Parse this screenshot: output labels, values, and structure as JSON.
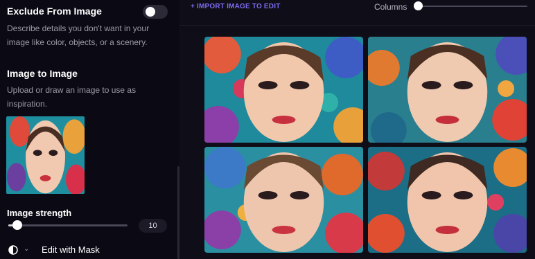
{
  "sidebar": {
    "exclude": {
      "title": "Exclude From Image",
      "description": "Describe details you don't want in your image like color, objects, or a scenery.",
      "toggle_on": false
    },
    "image_to_image": {
      "title": "Image to Image",
      "description": "Upload or draw an image to use as inspiration."
    },
    "strength": {
      "label": "Image strength",
      "value": "10"
    },
    "mask": {
      "icon": "contrast-icon",
      "label": "Edit with Mask"
    }
  },
  "toolbar": {
    "import_label": "+ IMPORT IMAGE TO EDIT",
    "columns_label": "Columns"
  },
  "colors": {
    "accent": "#7b6cf0",
    "background": "#0c0a14"
  }
}
